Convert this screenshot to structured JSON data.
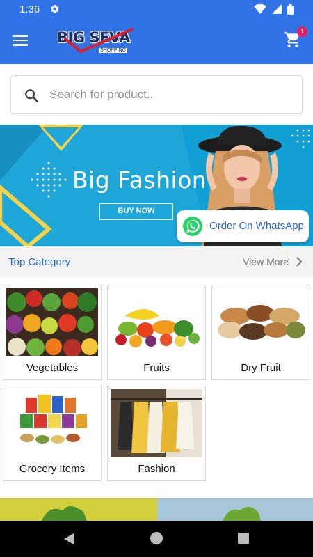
{
  "status_bar": {
    "time": "1:36"
  },
  "app_bar": {
    "logo_text": "BIG SEVA",
    "logo_subtext": "SHOPPING",
    "cart_count": "1",
    "colors": {
      "primary": "#2f73e6",
      "badge": "#e91e63"
    }
  },
  "search": {
    "placeholder": "Search for product.."
  },
  "banner": {
    "title": "Big Fashion",
    "button_label": "BUY NOW",
    "whatsapp_label": "Order On WhatsApp"
  },
  "category_section": {
    "title": "Top Category",
    "view_more_label": "View More",
    "items": [
      {
        "label": "Vegetables",
        "image": "vegetables-photo"
      },
      {
        "label": "Fruits",
        "image": "fruits-photo"
      },
      {
        "label": "Dry Fruit",
        "image": "dry-fruits-photo"
      },
      {
        "label": "Grocery Items",
        "image": "grocery-products-photo"
      },
      {
        "label": "Fashion",
        "image": "clothing-rack-photo"
      }
    ]
  },
  "icons": [
    "menu-icon",
    "settings-icon",
    "wifi-icon",
    "signal-icon",
    "battery-icon",
    "cart-icon",
    "search-icon",
    "whatsapp-icon",
    "chevron-right-icon",
    "back-icon",
    "home-icon",
    "recents-icon"
  ]
}
